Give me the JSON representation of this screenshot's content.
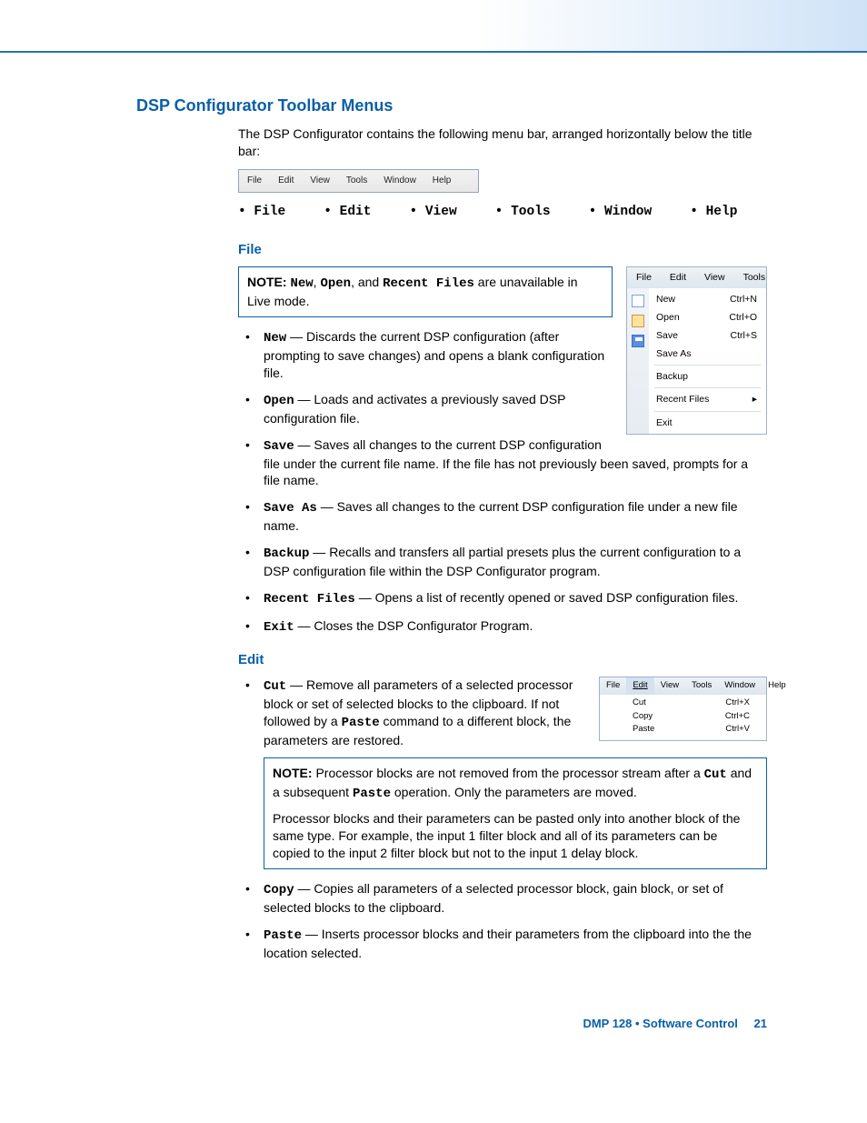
{
  "heading_main": "DSP Configurator Toolbar Menus",
  "intro": "The DSP Configurator contains the following menu bar, arranged horizontally below the title bar:",
  "toolbar_items": [
    "File",
    "Edit",
    "View",
    "Tools",
    "Window",
    "Help"
  ],
  "bullet_prefix": "• ",
  "menu_bullets": [
    "File",
    "Edit",
    "View",
    "Tools",
    "Window",
    "Help"
  ],
  "file": {
    "heading": "File",
    "note_label": "NOTE:",
    "note_html_parts": {
      "t1": "New",
      "sep1": ", ",
      "t2": "Open",
      "sep2": ", and ",
      "t3": "Recent Files",
      "tail": " are unavailable in Live mode."
    },
    "dropdown": {
      "head": [
        "File",
        "Edit",
        "View",
        "Tools"
      ],
      "rows": [
        {
          "label": "New",
          "short": "Ctrl+N",
          "icon": "new"
        },
        {
          "label": "Open",
          "short": "Ctrl+O",
          "icon": "open"
        },
        {
          "label": "Save",
          "short": "Ctrl+S",
          "icon": "save"
        },
        {
          "label": "Save As",
          "short": ""
        },
        {
          "div": true
        },
        {
          "label": "Backup",
          "short": ""
        },
        {
          "div": true
        },
        {
          "label": "Recent Files",
          "short": "▸"
        },
        {
          "div": true
        },
        {
          "label": "Exit",
          "short": ""
        }
      ]
    },
    "items": [
      {
        "term": "New",
        "desc": " — Discards the current DSP configuration (after prompting to save changes) and opens a blank configuration file."
      },
      {
        "term": "Open",
        "desc": " — Loads and activates a previously saved DSP configuration file."
      },
      {
        "term": "Save",
        "desc": " — Saves all changes to the current DSP configuration file under the current file name. If the file has not previously been saved, prompts for a file name."
      },
      {
        "term": "Save As",
        "desc": " — Saves all changes to the current DSP configuration file under a new file name."
      },
      {
        "term": "Backup",
        "desc": " — Recalls and transfers all partial presets plus the current configuration to a DSP configuration file within the DSP Configurator program."
      },
      {
        "term": "Recent Files",
        "desc": " — Opens a list of recently opened or saved DSP configuration files."
      },
      {
        "term": "Exit",
        "desc": " — Closes the DSP Configurator Program."
      }
    ]
  },
  "edit": {
    "heading": "Edit",
    "dropdown": {
      "head": [
        "File",
        "Edit",
        "View",
        "Tools",
        "Window",
        "Help"
      ],
      "rows": [
        {
          "label": "Cut",
          "short": "Ctrl+X"
        },
        {
          "label": "Copy",
          "short": "Ctrl+C"
        },
        {
          "label": "Paste",
          "short": "Ctrl+V"
        }
      ]
    },
    "items_top": [
      {
        "term": "Cut",
        "desc_pre": " — Remove all parameters of a selected processor block or set of selected blocks to the clipboard. If not followed by a ",
        "code": "Paste",
        "desc_post": " command to a different block, the parameters are restored."
      }
    ],
    "note_label": "NOTE:",
    "note_p1": {
      "pre": "Processor blocks are not removed from the processor stream after a ",
      "c1": "Cut",
      "mid": " and a subsequent ",
      "c2": "Paste",
      "post": " operation. Only the parameters are moved."
    },
    "note_p2": "Processor blocks and their parameters can be pasted only into another block of the same type. For example, the input 1 filter block and all of its parameters can be copied to the input 2 filter block but not to the input 1 delay block.",
    "items_bottom": [
      {
        "term": "Copy",
        "desc": " — Copies all parameters of a selected processor block, gain block, or set of selected blocks to the clipboard."
      },
      {
        "term": "Paste",
        "desc": " — Inserts processor blocks and their parameters from the clipboard into the the location selected."
      }
    ]
  },
  "footer": {
    "product": "DMP 128 • Software Control",
    "page": "21"
  }
}
